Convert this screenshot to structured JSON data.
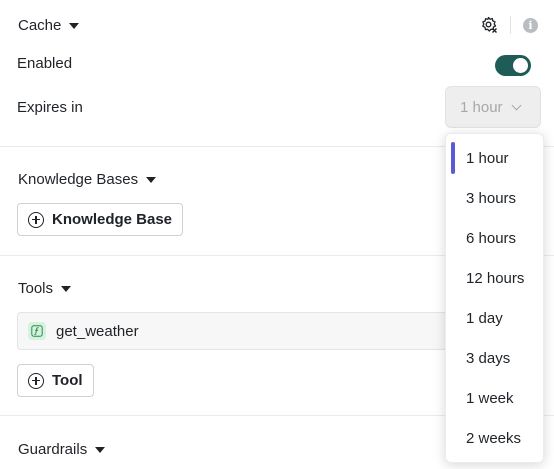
{
  "cache": {
    "title": "Cache",
    "enabled_label": "Enabled",
    "enabled": true,
    "expires_label": "Expires in",
    "expires_value": "1 hour"
  },
  "expiry_options": {
    "selected": "1 hour",
    "items": [
      "1 hour",
      "3 hours",
      "6 hours",
      "12 hours",
      "1 day",
      "3 days",
      "1 week",
      "2 weeks"
    ]
  },
  "knowledge_bases": {
    "title": "Knowledge Bases",
    "add_label": "Knowledge Base"
  },
  "tools": {
    "title": "Tools",
    "items": [
      {
        "name": "get_weather",
        "icon": "function-icon"
      }
    ],
    "add_label": "Tool"
  },
  "guardrails": {
    "title": "Guardrails"
  },
  "icons": {
    "settings": "gear-x-icon",
    "info": "info-icon",
    "caret": "caret-down-icon",
    "chevron": "chevron-down-icon",
    "plus": "plus-circle-icon"
  },
  "colors": {
    "toggle_on": "#1f5c57",
    "selected_accent": "#5b5bd6",
    "function_icon_bg": "#d4f2dd",
    "function_icon_fg": "#2f8a4f"
  }
}
